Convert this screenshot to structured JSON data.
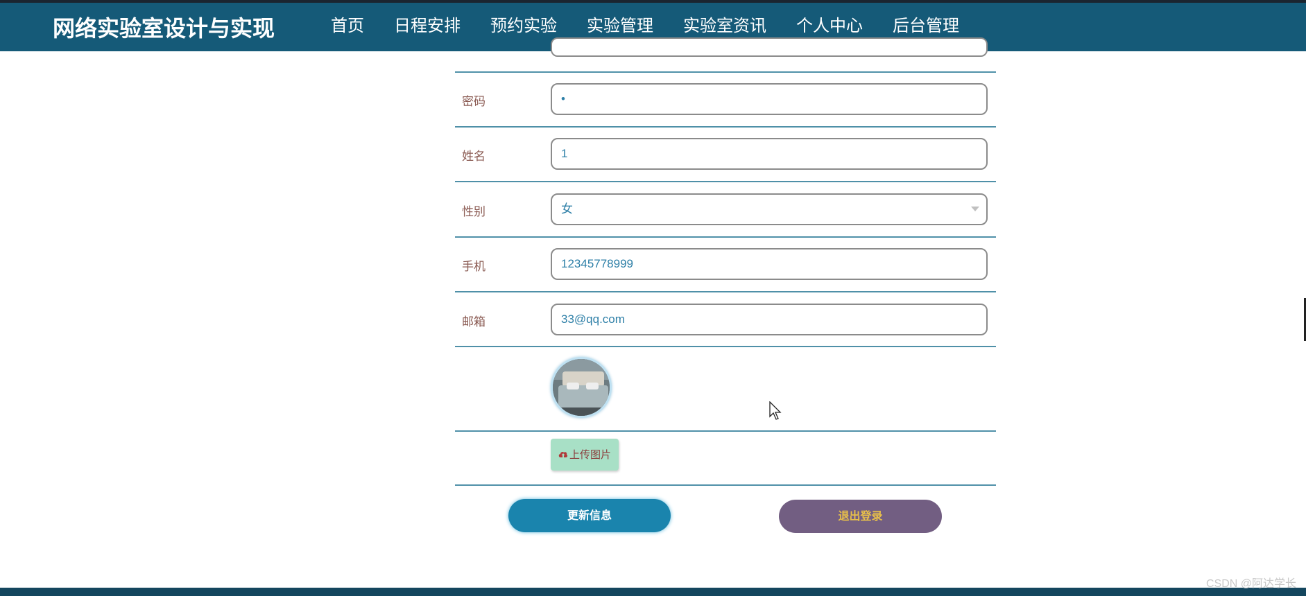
{
  "header": {
    "title": "网络实验室设计与实现",
    "nav": [
      "首页",
      "日程安排",
      "预约实验",
      "实验管理",
      "实验室资讯",
      "个人中心",
      "后台管理"
    ],
    "active": "个人中心"
  },
  "form": {
    "password": {
      "label": "密码",
      "value": "•"
    },
    "name": {
      "label": "姓名",
      "value": "1"
    },
    "gender": {
      "label": "性别",
      "value": "女"
    },
    "phone": {
      "label": "手机",
      "value": "12345778999"
    },
    "email": {
      "label": "邮箱",
      "value": "33@qq.com"
    },
    "upload_label": "上传图片"
  },
  "buttons": {
    "update": "更新信息",
    "logout": "退出登录"
  },
  "watermark": "CSDN @阿达学长",
  "colors": {
    "navbar": "#155a78",
    "update_button": "#1a84ad",
    "logout_button": "#725e82",
    "upload_button": "#a8e0c6"
  }
}
